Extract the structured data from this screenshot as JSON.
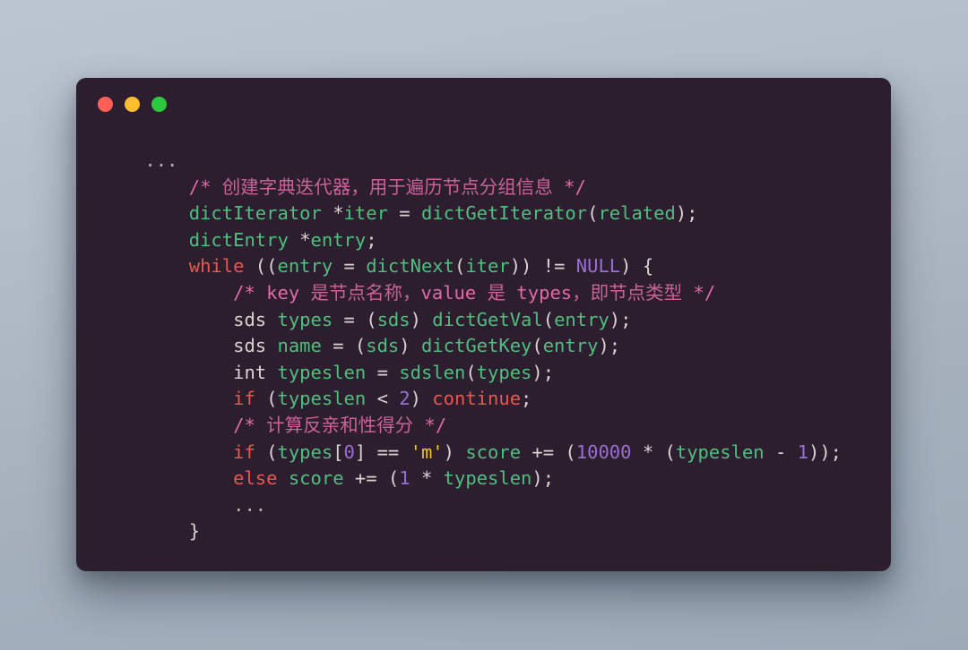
{
  "window": {
    "background_color": "#2d1e2f",
    "traffic_lights": [
      {
        "name": "close",
        "color": "#ff5f56"
      },
      {
        "name": "minimize",
        "color": "#febc2e"
      },
      {
        "name": "maximize",
        "color": "#2bc840"
      }
    ]
  },
  "theme": {
    "page_background": "#aeb9c4",
    "foreground": "#d9d4d1",
    "keyword": "#e8584f",
    "identifier": "#4fbf7e",
    "number": "#9a6fd4",
    "string": "#f5c518",
    "comment": "#e06aa8"
  },
  "code": {
    "language": "c",
    "ellipsis_top": "...",
    "ellipsis_inner": "...",
    "lines": [
      {
        "indent": 4,
        "tokens": [
          {
            "t": "...",
            "c": "dots"
          }
        ]
      },
      {
        "indent": 8,
        "tokens": [
          {
            "t": "/* ",
            "c": "cmt"
          },
          {
            "t": "创建字典迭代器，用于遍历节点分组信息",
            "c": "cmt-cjk"
          },
          {
            "t": " */",
            "c": "cmt"
          }
        ]
      },
      {
        "indent": 8,
        "tokens": [
          {
            "t": "dictIterator",
            "c": "id"
          },
          {
            "t": " ",
            "c": "punct"
          },
          {
            "t": "*",
            "c": "punct"
          },
          {
            "t": "iter",
            "c": "id"
          },
          {
            "t": " = ",
            "c": "punct"
          },
          {
            "t": "dictGetIterator",
            "c": "id"
          },
          {
            "t": "(",
            "c": "punct"
          },
          {
            "t": "related",
            "c": "id"
          },
          {
            "t": ");",
            "c": "punct"
          }
        ]
      },
      {
        "indent": 8,
        "tokens": [
          {
            "t": "dictEntry",
            "c": "id"
          },
          {
            "t": " ",
            "c": "punct"
          },
          {
            "t": "*",
            "c": "punct"
          },
          {
            "t": "entry",
            "c": "id"
          },
          {
            "t": ";",
            "c": "punct"
          }
        ]
      },
      {
        "indent": 8,
        "tokens": [
          {
            "t": "while",
            "c": "kw"
          },
          {
            "t": " ((",
            "c": "punct"
          },
          {
            "t": "entry",
            "c": "id"
          },
          {
            "t": " = ",
            "c": "punct"
          },
          {
            "t": "dictNext",
            "c": "id"
          },
          {
            "t": "(",
            "c": "punct"
          },
          {
            "t": "iter",
            "c": "id"
          },
          {
            "t": ")) != ",
            "c": "punct"
          },
          {
            "t": "NULL",
            "c": "num"
          },
          {
            "t": ") {",
            "c": "punct"
          }
        ]
      },
      {
        "indent": 12,
        "tokens": [
          {
            "t": "/* key ",
            "c": "cmt"
          },
          {
            "t": "是节点名称，",
            "c": "cmt-cjk"
          },
          {
            "t": "value ",
            "c": "cmt"
          },
          {
            "t": "是",
            "c": "cmt-cjk"
          },
          {
            "t": " types",
            "c": "cmt"
          },
          {
            "t": "，即节点类型",
            "c": "cmt-cjk"
          },
          {
            "t": " */",
            "c": "cmt"
          }
        ]
      },
      {
        "indent": 12,
        "tokens": [
          {
            "t": "sds",
            "c": "type"
          },
          {
            "t": " ",
            "c": "punct"
          },
          {
            "t": "types",
            "c": "id"
          },
          {
            "t": " = (",
            "c": "punct"
          },
          {
            "t": "sds",
            "c": "id"
          },
          {
            "t": ") ",
            "c": "punct"
          },
          {
            "t": "dictGetVal",
            "c": "id"
          },
          {
            "t": "(",
            "c": "punct"
          },
          {
            "t": "entry",
            "c": "id"
          },
          {
            "t": ");",
            "c": "punct"
          }
        ]
      },
      {
        "indent": 12,
        "tokens": [
          {
            "t": "sds",
            "c": "type"
          },
          {
            "t": " ",
            "c": "punct"
          },
          {
            "t": "name",
            "c": "id"
          },
          {
            "t": " = (",
            "c": "punct"
          },
          {
            "t": "sds",
            "c": "id"
          },
          {
            "t": ") ",
            "c": "punct"
          },
          {
            "t": "dictGetKey",
            "c": "id"
          },
          {
            "t": "(",
            "c": "punct"
          },
          {
            "t": "entry",
            "c": "id"
          },
          {
            "t": ");",
            "c": "punct"
          }
        ]
      },
      {
        "indent": 12,
        "tokens": [
          {
            "t": "int",
            "c": "type"
          },
          {
            "t": " ",
            "c": "punct"
          },
          {
            "t": "typeslen",
            "c": "id"
          },
          {
            "t": " = ",
            "c": "punct"
          },
          {
            "t": "sdslen",
            "c": "id"
          },
          {
            "t": "(",
            "c": "punct"
          },
          {
            "t": "types",
            "c": "id"
          },
          {
            "t": ");",
            "c": "punct"
          }
        ]
      },
      {
        "indent": 12,
        "tokens": [
          {
            "t": "if",
            "c": "kw"
          },
          {
            "t": " (",
            "c": "punct"
          },
          {
            "t": "typeslen",
            "c": "id"
          },
          {
            "t": " < ",
            "c": "punct"
          },
          {
            "t": "2",
            "c": "num"
          },
          {
            "t": ") ",
            "c": "punct"
          },
          {
            "t": "continue",
            "c": "kw"
          },
          {
            "t": ";",
            "c": "punct"
          }
        ]
      },
      {
        "indent": 12,
        "tokens": [
          {
            "t": "/* ",
            "c": "cmt"
          },
          {
            "t": "计算反亲和性得分",
            "c": "cmt-cjk"
          },
          {
            "t": " */",
            "c": "cmt"
          }
        ]
      },
      {
        "indent": 12,
        "tokens": [
          {
            "t": "if",
            "c": "kw"
          },
          {
            "t": " (",
            "c": "punct"
          },
          {
            "t": "types",
            "c": "id"
          },
          {
            "t": "[",
            "c": "punct"
          },
          {
            "t": "0",
            "c": "num"
          },
          {
            "t": "] == ",
            "c": "punct"
          },
          {
            "t": "'m'",
            "c": "str"
          },
          {
            "t": ") ",
            "c": "punct"
          },
          {
            "t": "score",
            "c": "id"
          },
          {
            "t": " += (",
            "c": "punct"
          },
          {
            "t": "10000",
            "c": "num"
          },
          {
            "t": " * (",
            "c": "punct"
          },
          {
            "t": "typeslen",
            "c": "id"
          },
          {
            "t": " - ",
            "c": "punct"
          },
          {
            "t": "1",
            "c": "num"
          },
          {
            "t": "));",
            "c": "punct"
          }
        ]
      },
      {
        "indent": 12,
        "tokens": [
          {
            "t": "else",
            "c": "kw"
          },
          {
            "t": " ",
            "c": "punct"
          },
          {
            "t": "score",
            "c": "id"
          },
          {
            "t": " += (",
            "c": "punct"
          },
          {
            "t": "1",
            "c": "num"
          },
          {
            "t": " * ",
            "c": "punct"
          },
          {
            "t": "typeslen",
            "c": "id"
          },
          {
            "t": ");",
            "c": "punct"
          }
        ]
      },
      {
        "indent": 12,
        "tokens": [
          {
            "t": "...",
            "c": "dots"
          }
        ]
      },
      {
        "indent": 8,
        "tokens": [
          {
            "t": "}",
            "c": "punct"
          }
        ]
      }
    ]
  }
}
